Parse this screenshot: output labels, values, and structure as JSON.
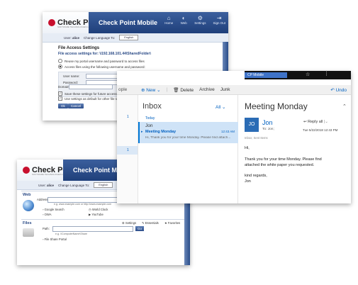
{
  "fileaccess": {
    "logo": "Check Point",
    "logo_sub": "SOFTWARE TECHNOLOGIES LTD.",
    "title": "Check Point Mobile",
    "nav": [
      "Home",
      "Web",
      "Settings",
      "Sign Out"
    ],
    "user_label": "User:",
    "user": "alice",
    "lang_label": "Change Language To:",
    "lang_value": "English",
    "settings_title": "File Access Settings",
    "settings_for": "File access settings for: \\\\192.168.101.44\\SharedFolder\\",
    "opt1": "Reuse my portal username and password to access files",
    "opt2": "Access files using the following username and password:",
    "username": "User name:",
    "password": "Password:",
    "domain": "Domain:",
    "save_chk": "Save these settings for future access.",
    "default_chk": "Use settings as default for other file shares.",
    "ok": "Ok",
    "cancel": "Cancel"
  },
  "outlook": {
    "tab": "CP Mobile",
    "people": "ople",
    "new": "New",
    "delete": "Delete",
    "archive": "Archive",
    "junk": "Junk",
    "undo": "Undo",
    "folder": "Inbox",
    "filter": "All",
    "today": "Today",
    "left_counts": [
      "1",
      "1"
    ],
    "msg_sender": "Jon",
    "msg_subject": "Meeting Monday",
    "msg_time": "12:43 AM",
    "msg_preview": "Hi,   Thank you for your time Monday. Please find attach...",
    "read_subject": "Meeting Monday",
    "avatar": "JO",
    "read_sender": "Jon",
    "read_to": "To: Jon;",
    "reply_all": "Reply all",
    "read_date": "Tue 5/22/2018 12:43 PM",
    "read_folder": "Inbox; Sent Items",
    "body_greeting": "Hi,",
    "body_line1": "Thank you for your time Monday.  Please find",
    "body_line2": "attached the white paper you requested.",
    "body_regards": "kind regards,",
    "body_sign": "Jon"
  },
  "webfiles": {
    "logo": "Check Point",
    "logo_sub": "SOFTWARE TECHNOLOGIES LTD.",
    "title": "Check Point Mobile",
    "nav": [
      "Home",
      "Web",
      "Settings",
      "Sign Out"
    ],
    "user_label": "User:",
    "user": "alice",
    "lang_label": "Change Language To:",
    "lang_value": "English",
    "web_header": "Web",
    "essentials": "Essentials",
    "favorites": "Favorites",
    "address": "Address:",
    "go": "Go",
    "address_eg": "e.g.  www.example.com   or   http://www.example.com",
    "link1": "Google Search",
    "link2": "World Clock",
    "link3": "OWA",
    "link4": "YouTube",
    "files_header": "Files",
    "settings": "Settings",
    "path": "Path:",
    "path_eg": "e.g.  \\\\ComputerName\\Share",
    "file_share": "File Share Portal"
  }
}
